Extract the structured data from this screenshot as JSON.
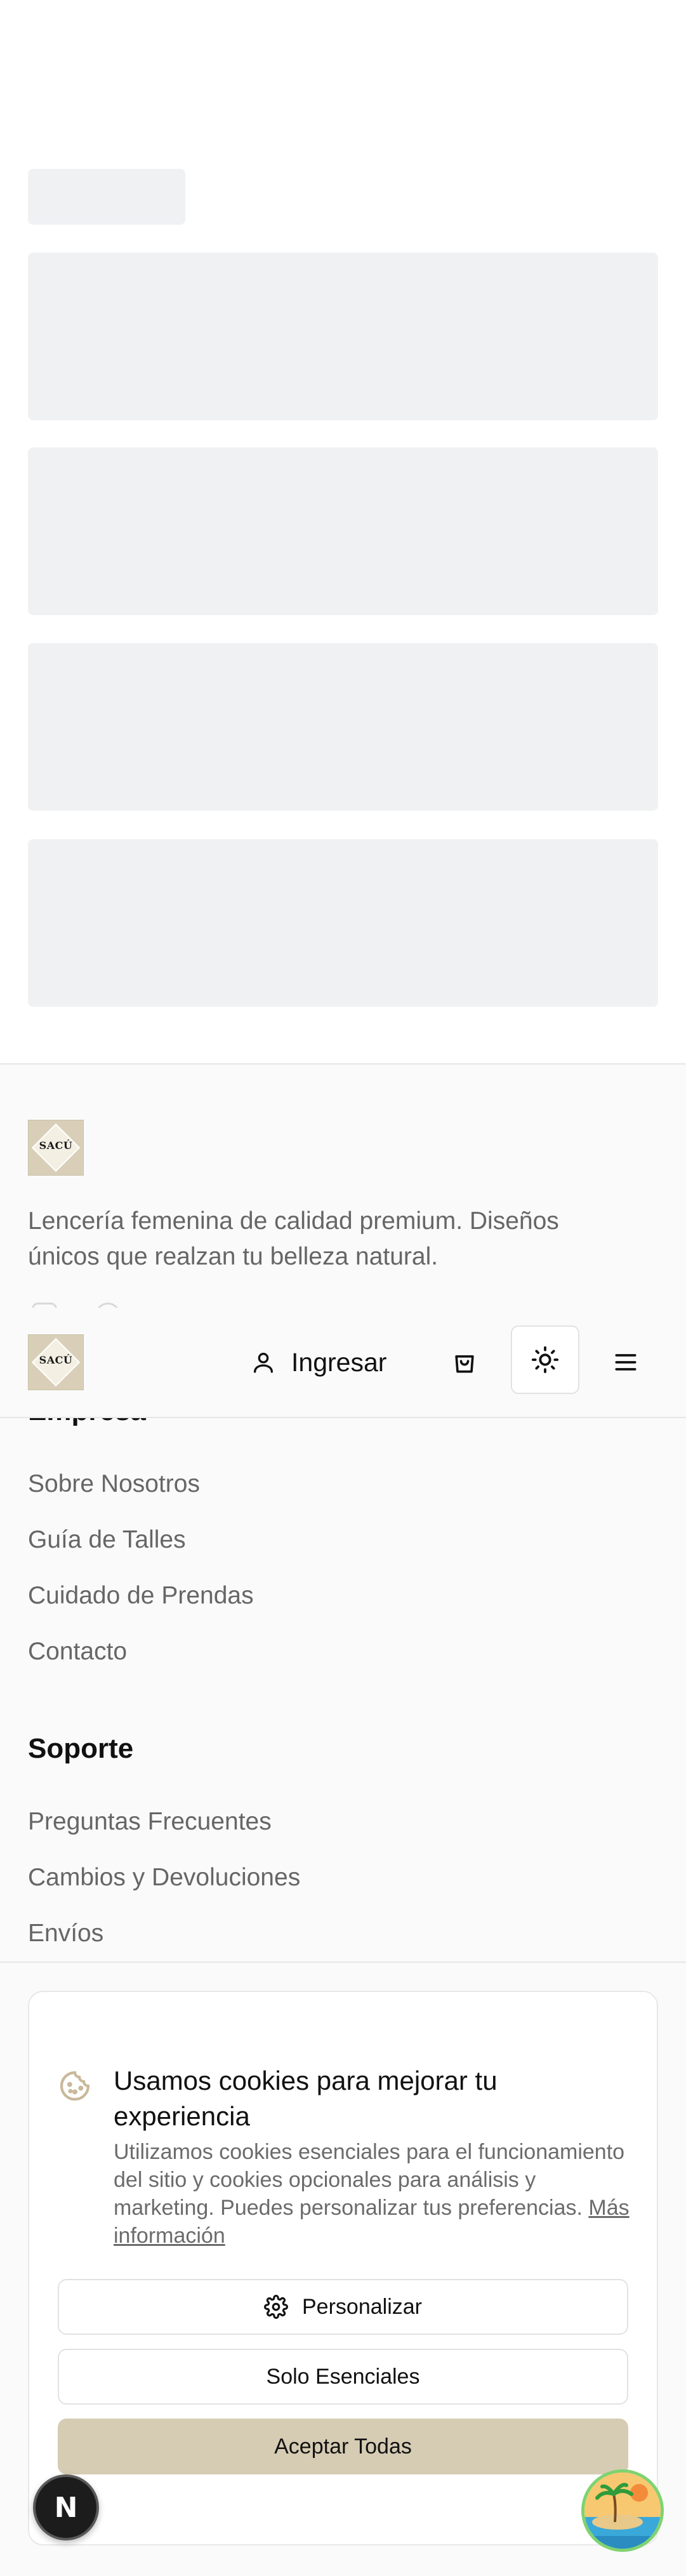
{
  "brand": {
    "logo_text": "SACÚ"
  },
  "footer": {
    "description": "Lencería femenina de calidad premium. Diseños únicos que realzan tu belleza natural.",
    "social": [
      {
        "icon": "instagram-icon"
      },
      {
        "icon": "facebook-icon"
      }
    ],
    "company": {
      "title": "Empresa",
      "links": [
        "Sobre Nosotros",
        "Guía de Talles",
        "Cuidado de Prendas",
        "Contacto"
      ]
    },
    "support": {
      "title": "Soporte",
      "links": [
        "Preguntas Frecuentes",
        "Cambios y Devoluciones",
        "Envíos"
      ]
    }
  },
  "header": {
    "login_label": "Ingresar",
    "icons": [
      "user-icon",
      "shopping-bag-icon",
      "sun-icon",
      "menu-icon"
    ]
  },
  "cookie_banner": {
    "icon": "cookie-icon",
    "title": "Usamos cookies para mejorar tu experiencia",
    "body": "Utilizamos cookies esenciales para el funcionamiento del sitio y cookies opcionales para análisis y marketing. Puedes personalizar tus preferencias.",
    "more_link": "Más información",
    "customize_label": "Personalizar",
    "essentials_label": "Solo Esenciales",
    "accept_label": "Aceptar Todas"
  },
  "dev_badge": {
    "letter": "N"
  },
  "colors": {
    "accent": "#d6ccb4",
    "skeleton": "#f0f1f3",
    "muted_text": "#666666"
  }
}
